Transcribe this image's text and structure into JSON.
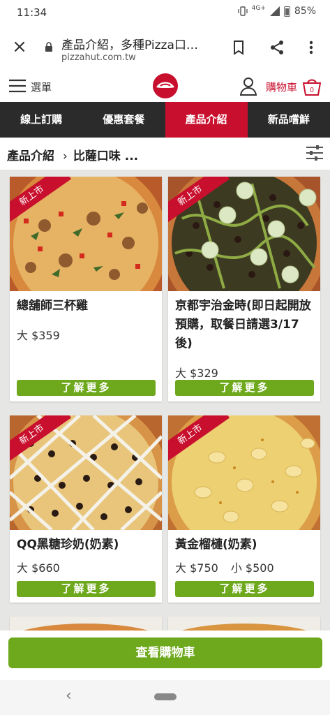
{
  "status": {
    "time": "11:34",
    "network": "4G+",
    "battery": "85%"
  },
  "browser": {
    "title": "產品介紹，多種Pizza口…",
    "url": "pizzahut.com.tw"
  },
  "header": {
    "menu_label": "選單",
    "cart_label": "購物車",
    "cart_count": "0"
  },
  "nav": {
    "tabs": [
      {
        "label": "線上訂購"
      },
      {
        "label": "優惠套餐"
      },
      {
        "label": "產品介紹",
        "active": true
      },
      {
        "label": "新品嚐鮮"
      }
    ]
  },
  "breadcrumb": {
    "first": "產品介紹",
    "sep": "›",
    "second": "比薩口味 ..."
  },
  "products": [
    {
      "name": "總舖師三杯雞",
      "badge": "新上市",
      "prices": [
        "大 $359"
      ],
      "button": "了解更多"
    },
    {
      "name": "京都宇治金時(即日起開放預購，取餐日請選3/17後)",
      "badge": "新上市",
      "prices": [
        "大 $329"
      ],
      "button": "了解更多"
    },
    {
      "name": "QQ黑糖珍奶(奶素)",
      "badge": "新上市",
      "prices": [
        "大 $660"
      ],
      "button": "了解更多"
    },
    {
      "name": "黃金榴槤(奶素)",
      "badge": "新上市",
      "prices": [
        "大 $750",
        "小 $500"
      ],
      "button": "了解更多"
    }
  ],
  "checkout": {
    "label": "查看購物車"
  },
  "colors": {
    "brand_red": "#c8102e",
    "button_green": "#6ea81c",
    "nav_dark": "#2b2b2b"
  }
}
